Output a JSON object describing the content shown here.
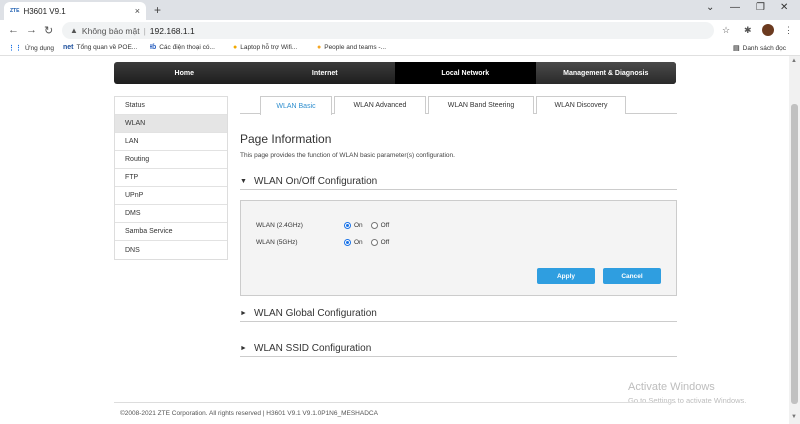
{
  "browser": {
    "tab_favicon": "ZTE",
    "tab_title": "H3601 V9.1",
    "tab_close": "×",
    "new_tab": "+",
    "security_label": "Không bảo mật",
    "url": "192.168.1.1",
    "bookmarks": [
      {
        "icon": "grid-icon",
        "glyph": "⋮⋮",
        "label": "Ứng dụng"
      },
      {
        "icon": "net-icon",
        "glyph": "net",
        "label": "Tổng quan về POE..."
      },
      {
        "icon": "tb-icon",
        "glyph": "Ɨɓ",
        "label": "Các điện thoại có..."
      },
      {
        "icon": "laptop-icon",
        "glyph": "●",
        "label": "Laptop hỗ trợ Wifi..."
      },
      {
        "icon": "people-icon",
        "glyph": "●",
        "label": "People and teams -..."
      }
    ],
    "reading_list": "Danh sách đọc"
  },
  "router": {
    "topnav": [
      "Home",
      "Internet",
      "Local Network",
      "Management & Diagnosis"
    ],
    "topnav_active": "Local Network",
    "sidebar": [
      "Status",
      "WLAN",
      "LAN",
      "Routing",
      "FTP",
      "UPnP",
      "DMS",
      "Samba Service",
      "DNS"
    ],
    "sidebar_active": "WLAN",
    "subtabs": [
      "WLAN Basic",
      "WLAN Advanced",
      "WLAN Band Steering",
      "WLAN Discovery"
    ],
    "subtab_active": "WLAN Basic",
    "page_info_title": "Page Information",
    "page_info_desc": "This page provides the function of WLAN basic parameter(s) configuration.",
    "sections": {
      "onoff": {
        "arrow": "▼",
        "title": "WLAN On/Off Configuration"
      },
      "global": {
        "arrow": "►",
        "title": "WLAN Global Configuration"
      },
      "ssid": {
        "arrow": "►",
        "title": "WLAN SSID Configuration"
      }
    },
    "wlan_rows": [
      {
        "label": "WLAN (2.4GHz)",
        "on": "On",
        "off": "Off",
        "selected": "On"
      },
      {
        "label": "WLAN (5GHz)",
        "on": "On",
        "off": "Off",
        "selected": "On"
      }
    ],
    "apply_label": "Apply",
    "cancel_label": "Cancel",
    "footer": "©2008-2021 ZTE Corporation. All rights reserved  |  H3601 V9.1 V9.1.0P1N6_MESHADCA"
  },
  "watermark": {
    "line1": "Activate Windows",
    "line2": "Go to Settings to activate Windows."
  },
  "colors": {
    "accent": "#2f9ee0",
    "nav_bg": "#1e1e1e",
    "active_subtab": "#2e8ece"
  }
}
